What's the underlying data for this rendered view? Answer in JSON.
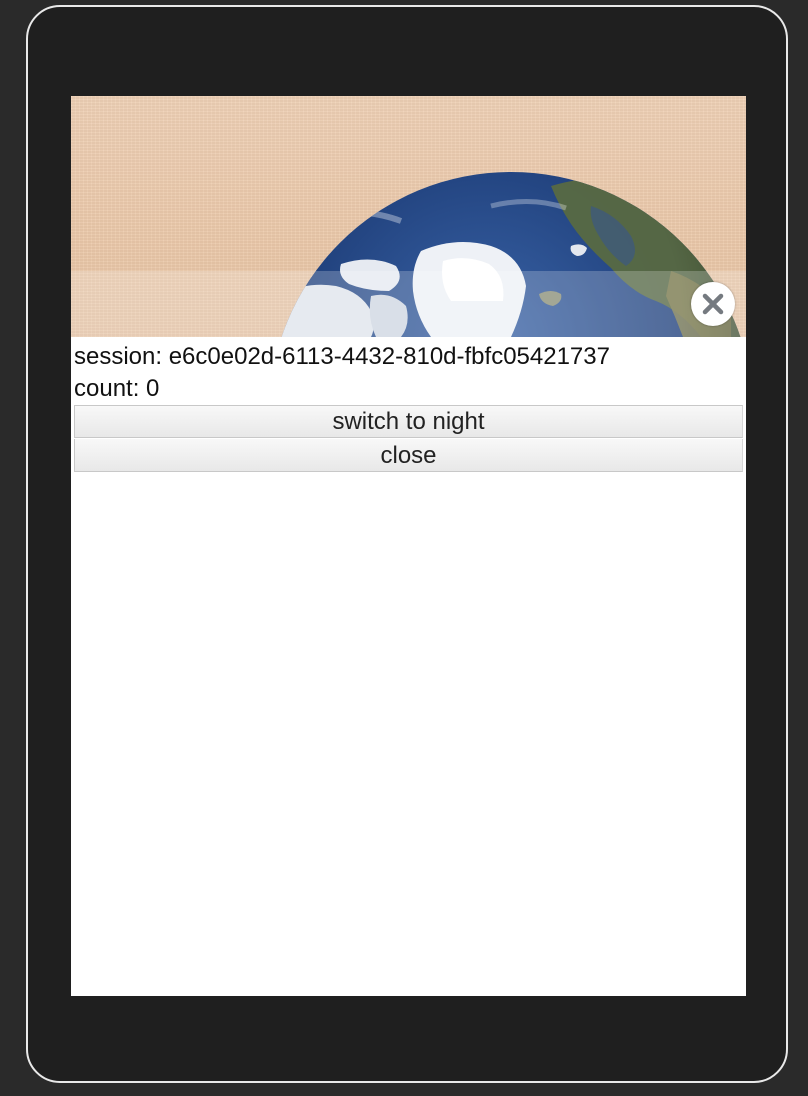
{
  "session": {
    "label": "session: e6c0e02d-6113-4432-810d-fbfc05421737"
  },
  "count": {
    "label": "count: 0"
  },
  "buttons": {
    "switch_label": "switch to night",
    "close_label": "close"
  },
  "icons": {
    "banner_close": "close-circle-icon"
  },
  "colors": {
    "bezel": "#1f1f1f",
    "banner_bg": "#eccaab",
    "ocean": "#1f3f7a",
    "ice": "#f4f6fa"
  }
}
